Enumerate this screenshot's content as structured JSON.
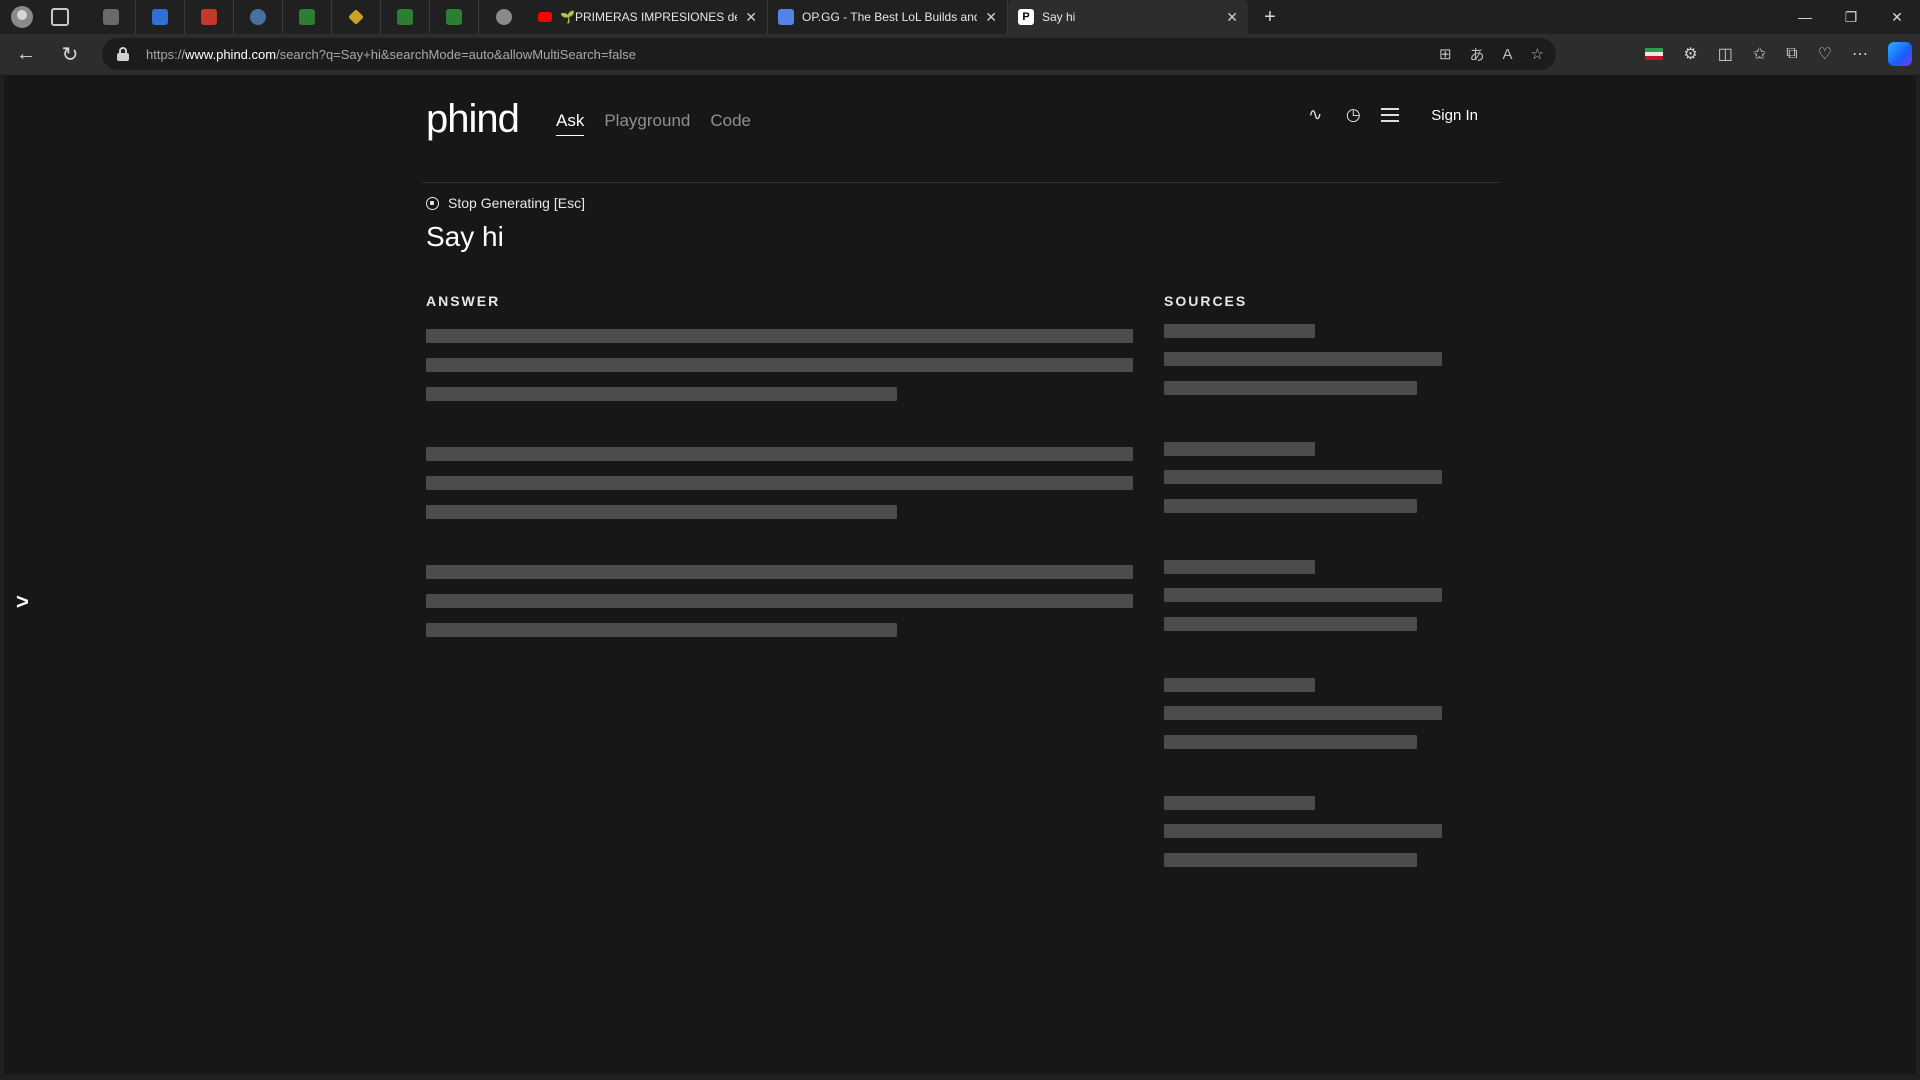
{
  "browser": {
    "tabs": [
      {
        "title": "🌱PRIMERAS IMPRESIONES de K",
        "favicon_color": "#ff0000"
      },
      {
        "title": "OP.GG - The Best LoL Builds and",
        "favicon_color": "#5383e8"
      },
      {
        "title": "Say hi",
        "favicon_color": "#ffffff"
      }
    ],
    "pinned_favicon_colors": [
      "#6b6b6b",
      "#2f6fd6",
      "#c0392b",
      "#4a6fa5",
      "#2e7d32",
      "#c9a227",
      "#2e7d32",
      "#2e7d32",
      "#8a8a8a"
    ],
    "url_prefix": "https://",
    "url_host": "www.phind.com",
    "url_path": "/search?q=Say+hi&searchMode=auto&allowMultiSearch=false"
  },
  "header": {
    "logo": "phind",
    "nav": [
      "Ask",
      "Playground",
      "Code"
    ],
    "active_nav": "Ask",
    "sign_in": "Sign In"
  },
  "status": {
    "stop_label": "Stop Generating [Esc]"
  },
  "query": "Say hi",
  "sections": {
    "answer_label": "ANSWER",
    "sources_label": "SOURCES"
  },
  "colors": {
    "page_bg": "#161717",
    "skeleton": "#4a4c4e",
    "text": "#ffffff",
    "muted": "#8e9092"
  }
}
